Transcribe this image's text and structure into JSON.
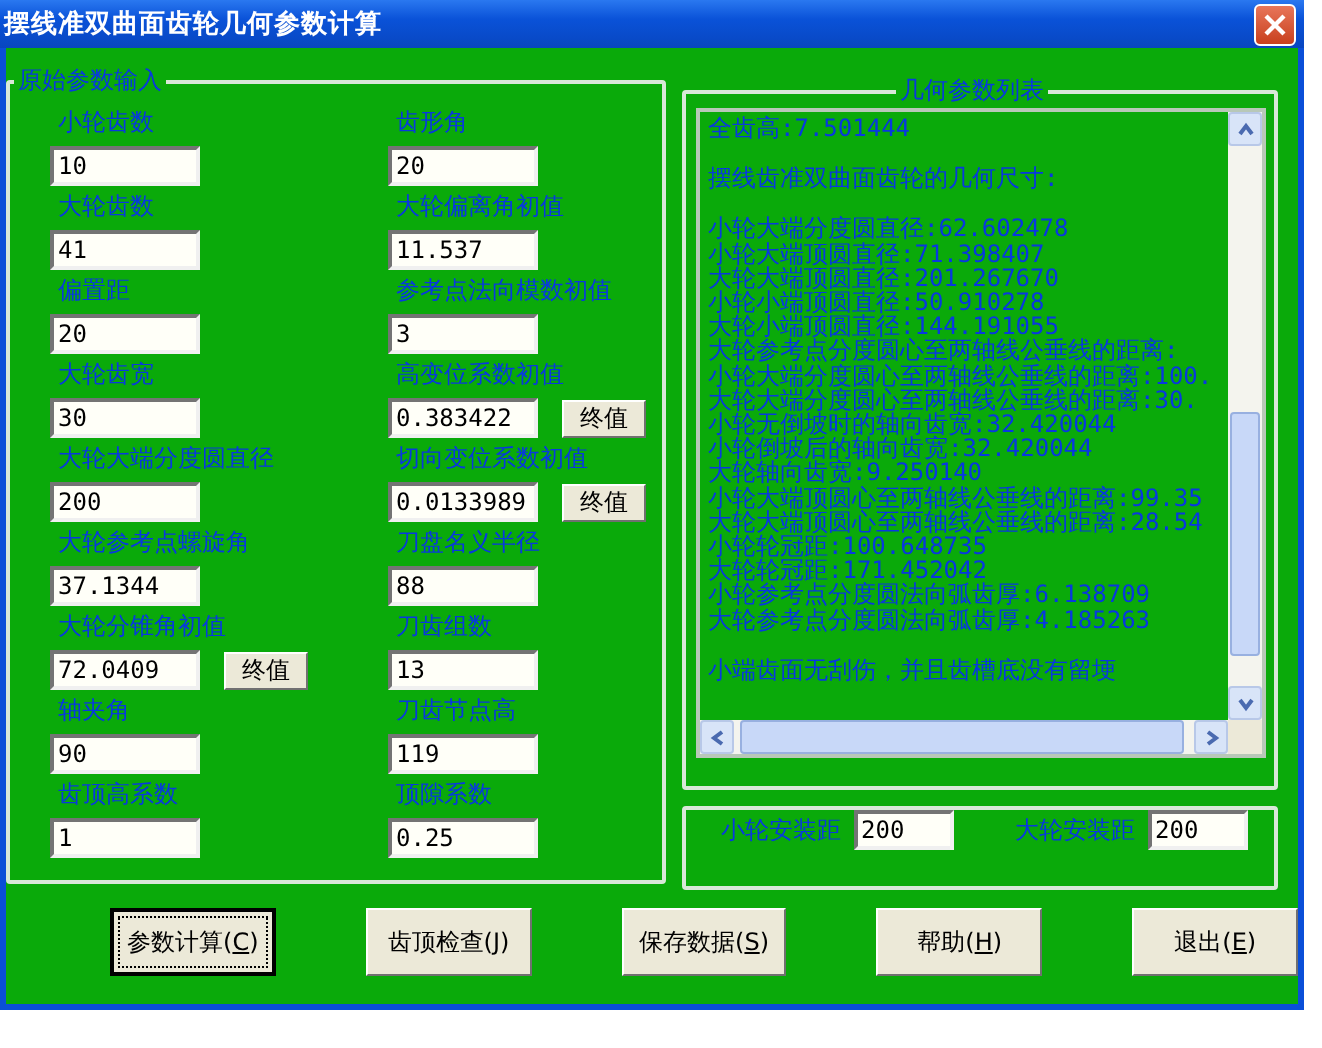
{
  "window": {
    "title": "摆线准双曲面齿轮几何参数计算"
  },
  "input_group": {
    "title": "原始参数输入",
    "columns": [
      [
        {
          "label": "小轮齿数",
          "value": "10"
        },
        {
          "label": "大轮齿数",
          "value": "41"
        },
        {
          "label": "偏置距",
          "value": "20"
        },
        {
          "label": "大轮齿宽",
          "value": "30"
        },
        {
          "label": "大轮大端分度圆直径",
          "value": "200"
        },
        {
          "label": "大轮参考点螺旋角",
          "value": "37.1344"
        },
        {
          "label": "大轮分锥角初值",
          "value": "72.0409",
          "button": "终值"
        },
        {
          "label": "轴夹角",
          "value": "90"
        },
        {
          "label": "齿顶高系数",
          "value": "1"
        }
      ],
      [
        {
          "label": "齿形角",
          "value": "20"
        },
        {
          "label": "大轮偏离角初值",
          "value": "11.537"
        },
        {
          "label": "参考点法向模数初值",
          "value": "3"
        },
        {
          "label": "高变位系数初值",
          "value": "0.383422",
          "button": "终值"
        },
        {
          "label": "切向变位系数初值",
          "value": "0.0133989",
          "button": "终值"
        },
        {
          "label": "刀盘名义半径",
          "value": "88"
        },
        {
          "label": "刀齿组数",
          "value": "13"
        },
        {
          "label": "刀齿节点高",
          "value": "119"
        },
        {
          "label": "顶隙系数",
          "value": "0.25"
        }
      ]
    ]
  },
  "results": {
    "title": "几何参数列表",
    "paragraphs": [
      [
        "全齿高:7.501444"
      ],
      [
        "摆线齿准双曲面齿轮的几何尺寸:"
      ],
      [
        "小轮大端分度圆直径:62.602478",
        "小轮大端顶圆直径:71.398407",
        "大轮大端顶圆直径:201.267670",
        "小轮小端顶圆直径:50.910278",
        "大轮小端顶圆直径:144.191055",
        "大轮参考点分度圆心至两轴线公垂线的距离:",
        "小轮大端分度圆心至两轴线公垂线的距离:100.",
        "大轮大端分度圆心至两轴线公垂线的距离:30.",
        "小轮无倒坡时的轴向齿宽:32.420044",
        "小轮倒坡后的轴向齿宽:32.420044",
        "大轮轴向齿宽:9.250140",
        "小轮大端顶圆心至两轴线公垂线的距离:99.35",
        "大轮大端顶圆心至两轴线公垂线的距离:28.54",
        "小轮轮冠距:100.648735",
        "大轮轮冠距:171.452042",
        "小轮参考点分度圆法向弧齿厚:6.138709",
        "大轮参考点分度圆法向弧齿厚:4.185263"
      ],
      [
        "小端齿面无刮伤，并且齿槽底没有留埂"
      ]
    ]
  },
  "install": {
    "fields": [
      {
        "label": "小轮安装距",
        "value": "200"
      },
      {
        "label": "大轮安装距",
        "value": "200"
      }
    ]
  },
  "buttons": [
    {
      "text_before": "参数计算(",
      "hotkey": "C",
      "text_after": ")",
      "focused": true
    },
    {
      "text_before": "齿顶检查(",
      "hotkey": "J",
      "text_after": ")",
      "focused": false
    },
    {
      "text_before": "保存数据(",
      "hotkey": "S",
      "text_after": ")",
      "focused": false
    },
    {
      "text_before": "帮助(",
      "hotkey": "H",
      "text_after": ")",
      "focused": false
    },
    {
      "text_before": "退出(",
      "hotkey": "E",
      "text_after": ")",
      "focused": false
    }
  ]
}
